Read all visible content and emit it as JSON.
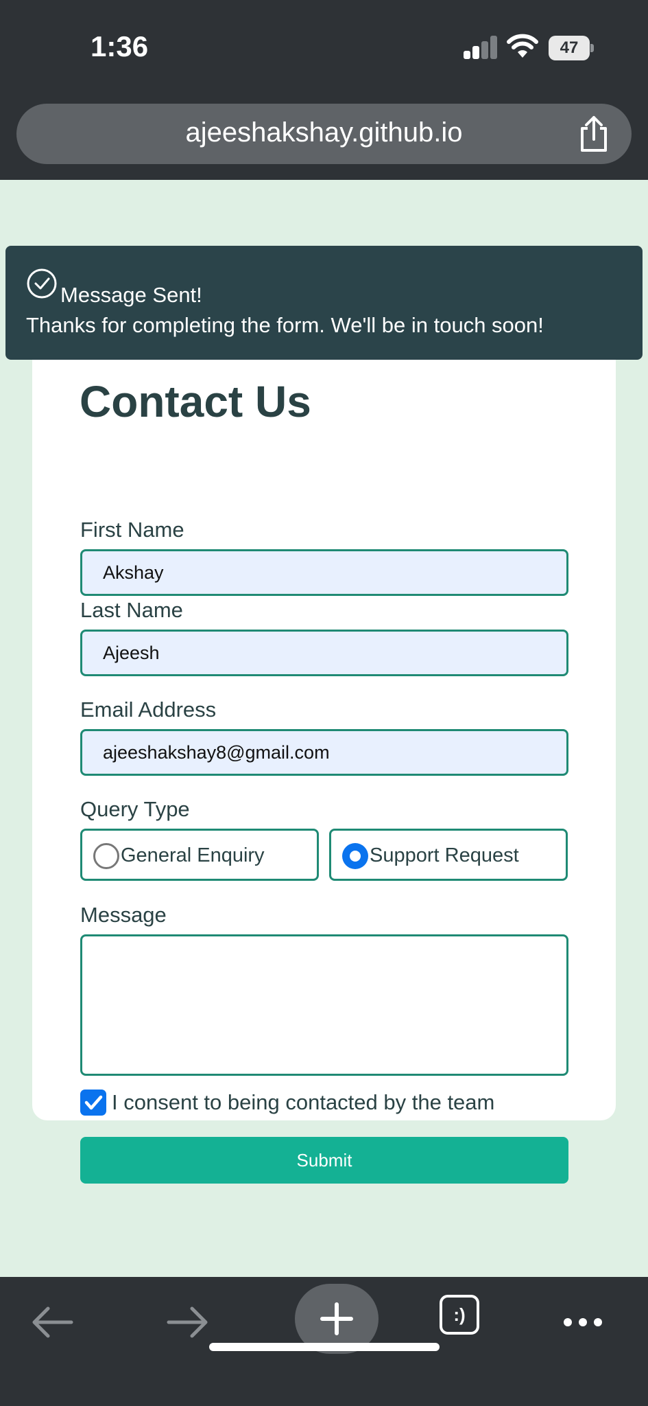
{
  "status_bar": {
    "time": "1:36",
    "battery": "47",
    "icons": [
      "cellular-signal-icon",
      "wifi-icon",
      "battery-icon"
    ]
  },
  "browser": {
    "url": "ajeeshakshay.github.io",
    "share_icon": "share-icon",
    "toolbar_icons": [
      "back-arrow-icon",
      "forward-arrow-icon",
      "plus-icon",
      "tabs-icon",
      "more-icon"
    ],
    "tabs_label": ":)"
  },
  "toast": {
    "icon": "check-circle-icon",
    "title": "Message Sent!",
    "message": "Thanks for completing the form. We'll be in touch soon!"
  },
  "form": {
    "title": "Contact Us",
    "first_name": {
      "label": "First Name",
      "value": "Akshay"
    },
    "last_name": {
      "label": "Last Name",
      "value": "Ajeesh"
    },
    "email": {
      "label": "Email Address",
      "value": "ajeeshakshay8@gmail.com"
    },
    "query_type": {
      "label": "Query Type",
      "options": [
        {
          "label": "General Enquiry",
          "selected": false
        },
        {
          "label": "Support Request",
          "selected": true
        }
      ]
    },
    "message": {
      "label": "Message",
      "value": ""
    },
    "consent": {
      "label": "I consent to being contacted by the team",
      "checked": true
    },
    "submit_label": "Submit"
  },
  "colors": {
    "page_bg": "#dff0e4",
    "accent": "#14b194",
    "border": "#1f8a74",
    "toast_bg": "#2b444a",
    "input_autofill_bg": "#e8f0fe",
    "control_blue": "#0a73ee",
    "browser_chrome": "#2e3236"
  }
}
